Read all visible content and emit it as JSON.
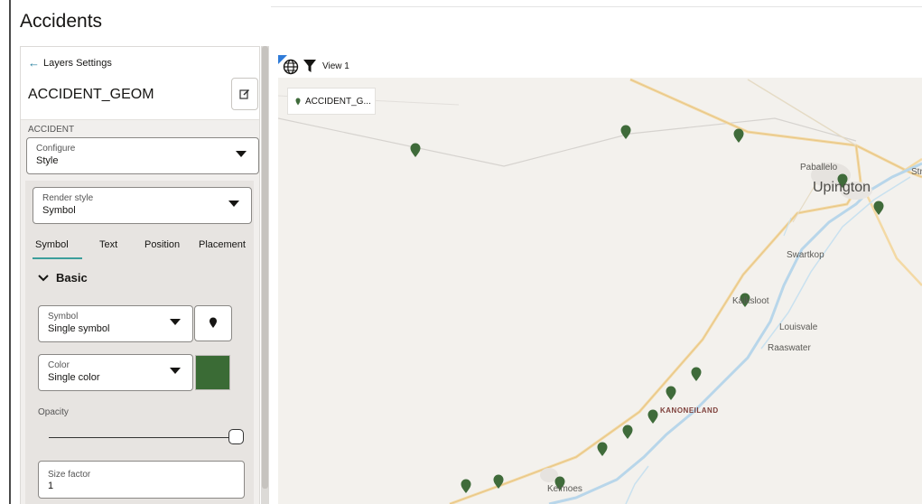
{
  "page": {
    "title": "Accidents"
  },
  "layers_panel": {
    "back_label": "Layers Settings",
    "layer_name": "ACCIDENT_GEOM",
    "section_label": "ACCIDENT",
    "configure": {
      "label": "Configure",
      "value": "Style"
    },
    "render_style": {
      "label": "Render style",
      "value": "Symbol"
    },
    "tabs": [
      "Symbol",
      "Text",
      "Position",
      "Placement"
    ],
    "active_tab": "Symbol",
    "basic_header": "Basic",
    "symbol": {
      "label": "Symbol",
      "value": "Single symbol"
    },
    "color": {
      "label": "Color",
      "value": "Single color",
      "swatch": "#3a6b35"
    },
    "opacity": {
      "label": "Opacity",
      "value": 1.0
    },
    "size_factor": {
      "label": "Size factor",
      "value": "1"
    }
  },
  "map": {
    "view_label": "View 1",
    "legend_label": "ACCIDENT_G...",
    "marker_color": "#3f6b3a",
    "places": {
      "paballelo": "Paballelo",
      "upington": "Upington",
      "str": "Str",
      "swartkop": "Swartkop",
      "kalksloot": "Kalksloot",
      "louisvale": "Louisvale",
      "raaswater": "Raaswater",
      "kanoneiland": "KANONEILAND",
      "keimoes": "Keimoes"
    }
  }
}
